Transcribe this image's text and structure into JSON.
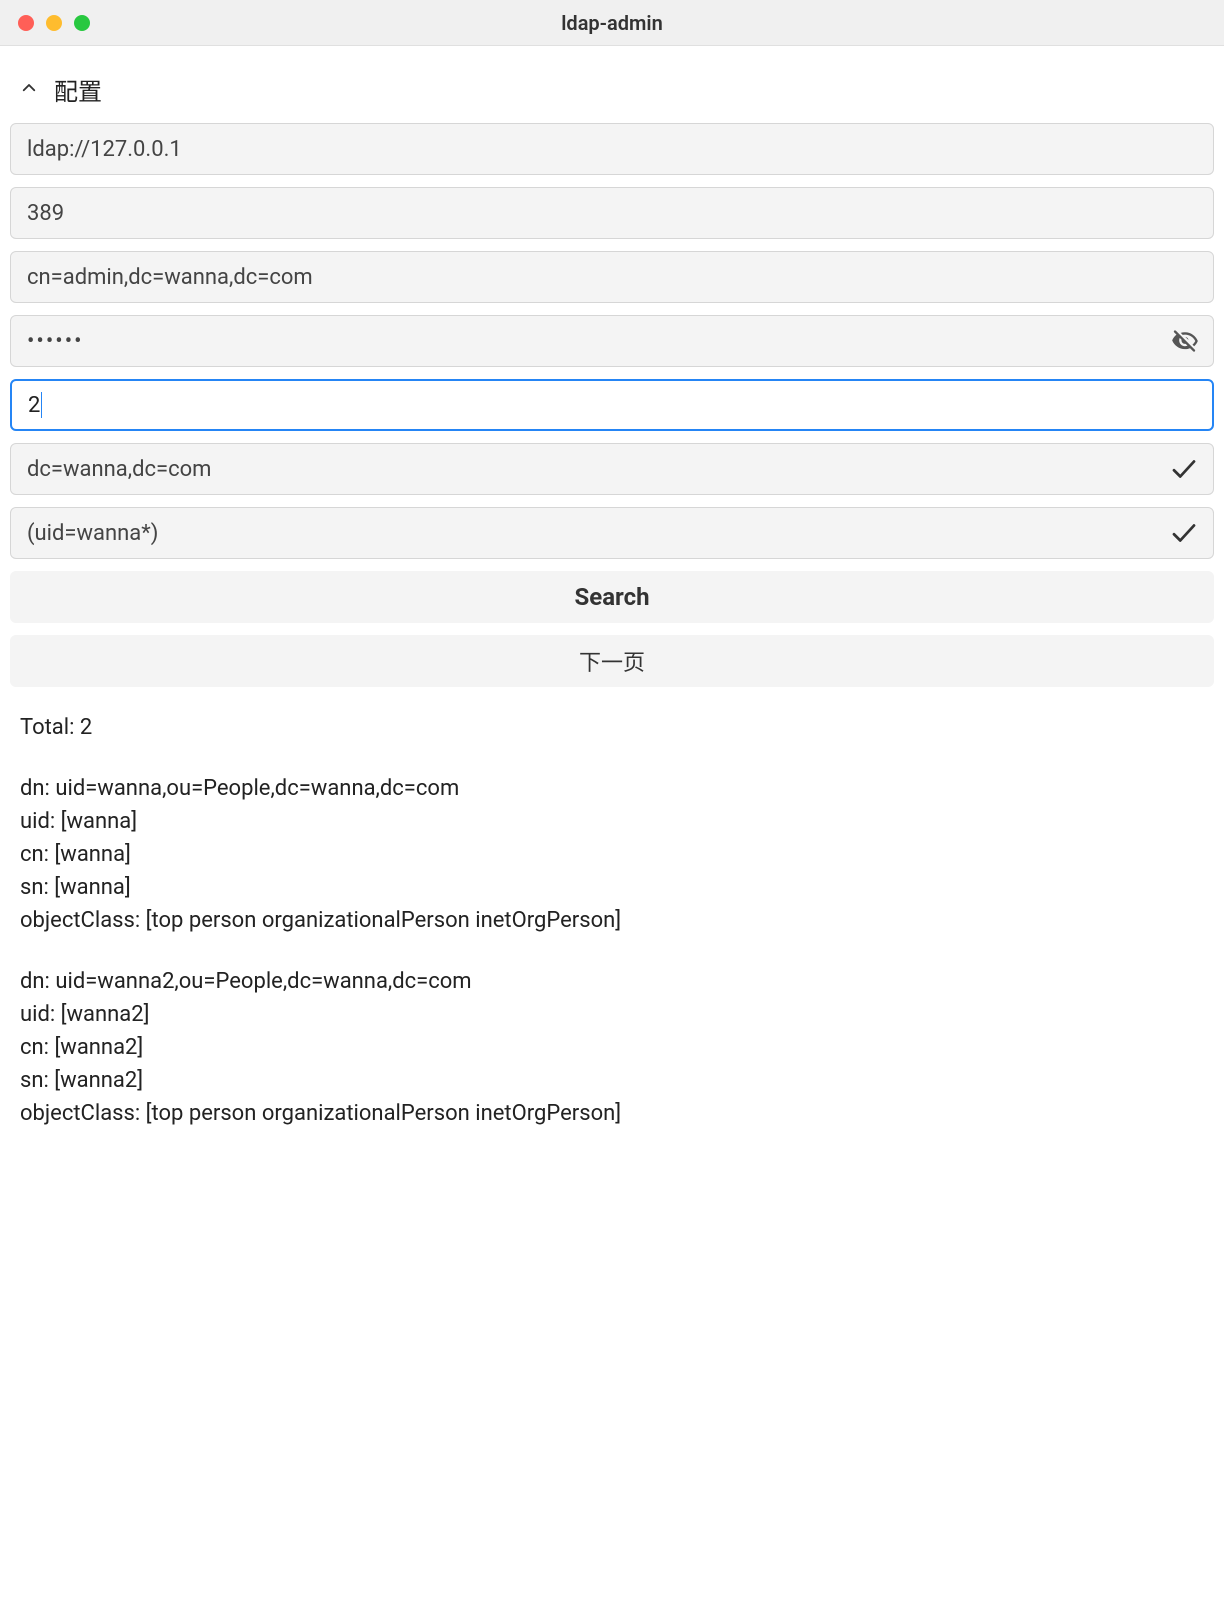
{
  "window": {
    "title": "ldap-admin"
  },
  "section": {
    "title": "配置"
  },
  "fields": {
    "url": "ldap://127.0.0.1",
    "port": "389",
    "bind_dn": "cn=admin,dc=wanna,dc=com",
    "password": "••••••",
    "page_size": "2",
    "base_dn": "dc=wanna,dc=com",
    "filter": "(uid=wanna*)"
  },
  "buttons": {
    "search": "Search",
    "next_page": "下一页"
  },
  "results": {
    "total_label": "Total: 2",
    "entries": [
      {
        "lines": [
          "dn: uid=wanna,ou=People,dc=wanna,dc=com",
          "uid: [wanna]",
          "cn: [wanna]",
          "sn: [wanna]",
          "objectClass: [top person organizationalPerson inetOrgPerson]"
        ]
      },
      {
        "lines": [
          "dn: uid=wanna2,ou=People,dc=wanna,dc=com",
          "uid: [wanna2]",
          "cn: [wanna2]",
          "sn: [wanna2]",
          "objectClass: [top person organizationalPerson inetOrgPerson]"
        ]
      }
    ]
  }
}
